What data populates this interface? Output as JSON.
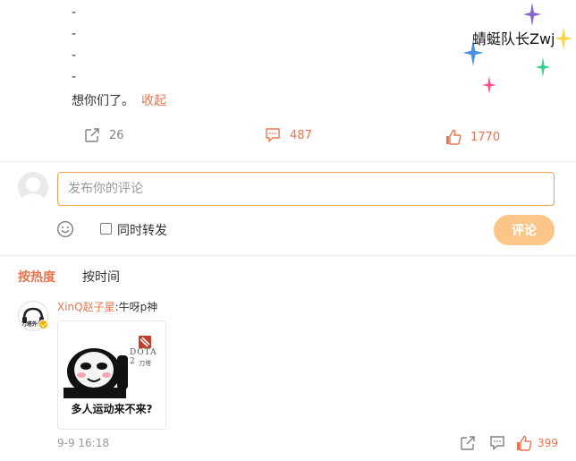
{
  "post": {
    "dashes": [
      "-",
      "-",
      "-",
      "-"
    ],
    "text": "想你们了。",
    "collapse_label": "收起"
  },
  "sticker": {
    "name": "蜻蜓队长Zwj",
    "colors": [
      "#8a63d2",
      "#f7d64a",
      "#4a90e2",
      "#3ecf8e",
      "#ff4f8b"
    ]
  },
  "actions": {
    "repost_icon": "share-icon",
    "repost_count": "26",
    "comment_icon": "comment-icon",
    "comment_count": "487",
    "like_icon": "thumbs-up-icon",
    "like_count": "1770"
  },
  "compose": {
    "placeholder": "发布你的评论",
    "emoji_icon": "smiley-icon",
    "repost_checkbox_label": "同时转发",
    "repost_checked": false,
    "submit_label": "评论"
  },
  "sort": {
    "tabs": [
      "按热度",
      "按时间"
    ],
    "active": "按热度"
  },
  "comments": [
    {
      "avatar_text": "刀塔外设7",
      "username": "XinQ赵子星",
      "text": ":牛呀p神",
      "image": {
        "caption": "多人运动来不来?",
        "logo_text": "DOTA 2",
        "logo_sub": "刀塔"
      },
      "time": "9-9 16:18",
      "like_count": "399"
    }
  ],
  "colors": {
    "accent": "#eb7350",
    "submit_disabled": "#fdc689",
    "input_border": "#f0a34a"
  }
}
